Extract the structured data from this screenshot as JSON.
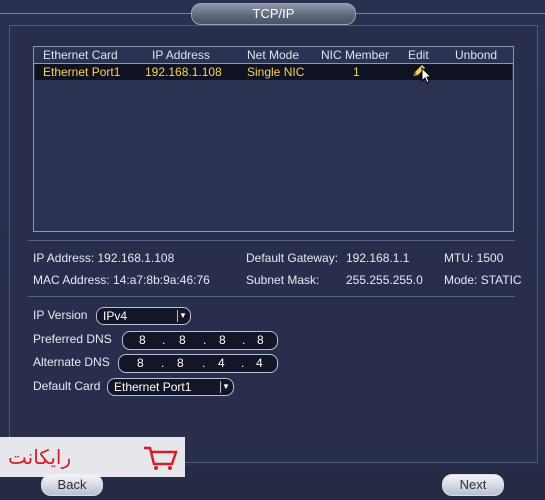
{
  "window": {
    "title": "TCP/IP"
  },
  "table": {
    "headers": [
      "Ethernet Card",
      "IP Address",
      "Net Mode",
      "NIC Member",
      "Edit",
      "Unbond"
    ],
    "rows": [
      {
        "card": "Ethernet Port1",
        "ip": "192.168.1.108",
        "mode": "Single NIC",
        "member": "1",
        "edit_icon": "pencil-icon"
      }
    ]
  },
  "info": {
    "ip_label": "IP Address:",
    "ip_value": "192.168.1.108",
    "mac_label": "MAC Address:",
    "mac_value": "14:a7:8b:9a:46:76",
    "gateway_label": "Default Gateway:",
    "gateway_value": "192.168.1.1",
    "subnet_label": "Subnet Mask:",
    "subnet_value": "255.255.255.0",
    "mtu_label": "MTU:",
    "mtu_value": "1500",
    "mode_label": "Mode:",
    "mode_value": "STATIC"
  },
  "form": {
    "ip_version_label": "IP Version",
    "ip_version_value": "IPv4",
    "preferred_dns_label": "Preferred DNS",
    "preferred_dns": [
      "8",
      "8",
      "8",
      "8"
    ],
    "alternate_dns_label": "Alternate DNS",
    "alternate_dns": [
      "8",
      "8",
      "4",
      "4"
    ],
    "default_card_label": "Default Card",
    "default_card_value": "Ethernet Port1"
  },
  "buttons": {
    "back": "Back",
    "next": "Next"
  },
  "watermark": {
    "text": "رایکانت"
  },
  "colors": {
    "selected_row_text": "#fbd35a",
    "watermark_red": "#d21f2a"
  }
}
